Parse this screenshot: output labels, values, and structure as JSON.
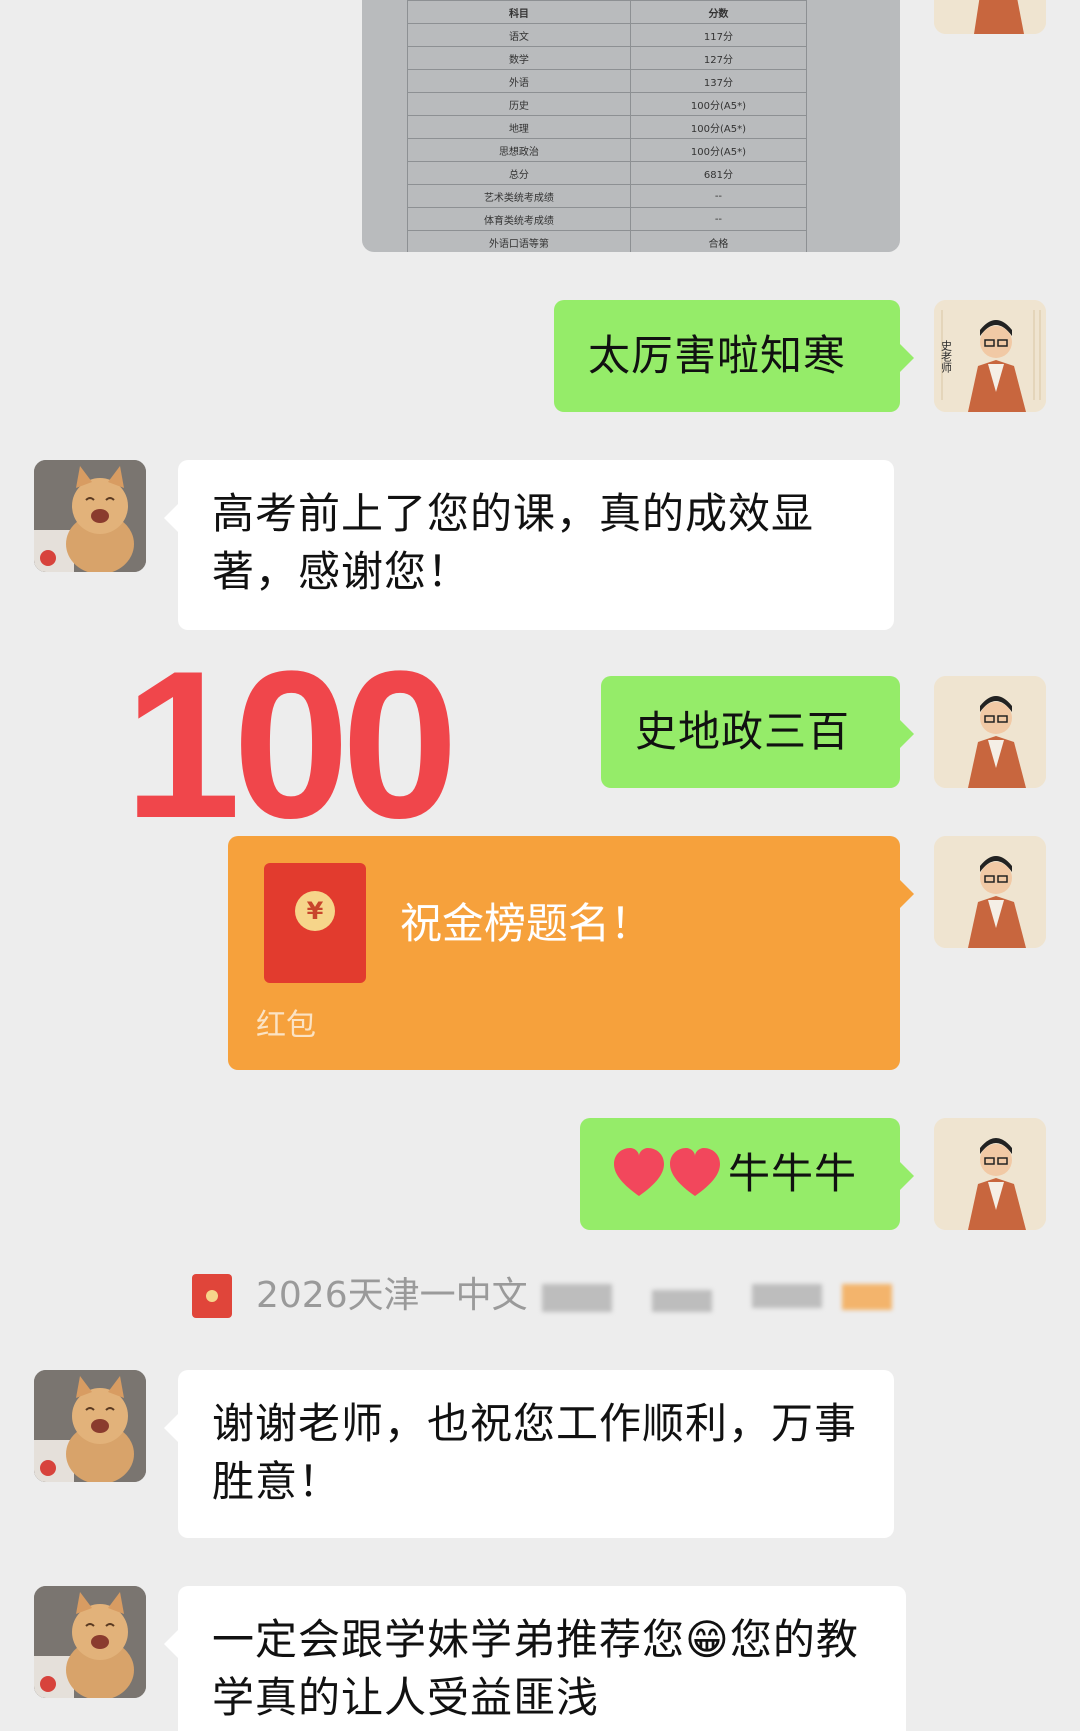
{
  "score_sheet": {
    "header": [
      "科目",
      "分数"
    ],
    "rows": [
      [
        "语文",
        "117分"
      ],
      [
        "数学",
        "127分"
      ],
      [
        "外语",
        "137分"
      ],
      [
        "历史",
        "100分(A5*)"
      ],
      [
        "地理",
        "100分(A5*)"
      ],
      [
        "思想政治",
        "100分(A5*)"
      ],
      [
        "总分",
        "681分"
      ],
      [
        "艺术类统考成绩",
        "--"
      ],
      [
        "体育类统考成绩",
        "--"
      ],
      [
        "外语口语等第",
        "合格"
      ]
    ]
  },
  "messages": {
    "m1": "太厉害啦知寒",
    "m2": "高考前上了您的课，真的成效显著，感谢您！",
    "big_sticker": "100",
    "m3": "史地政三百",
    "red_packet": {
      "greeting": "祝金榜题名！",
      "label": "红包",
      "coin": "¥"
    },
    "m4": "牛牛牛",
    "notice": "2026天津一中文",
    "m5": "谢谢老师，也祝您工作顺利，万事胜意！",
    "m6_part1": "一定会跟学妹学弟推荐您",
    "m6_emoji": "😁",
    "m6_part2": "您的教学真的让人受益匪浅"
  },
  "avatar_text": "史老师",
  "colors": {
    "green_bubble": "#95ec69",
    "red_packet": "#f6a13c",
    "big_number": "#f0464b",
    "background": "#ededed"
  },
  "icons": {
    "teacher": "teacher-avatar-icon",
    "student": "cat-avatar-icon",
    "packet": "red-envelope-icon",
    "hearts": "heart-icon"
  }
}
